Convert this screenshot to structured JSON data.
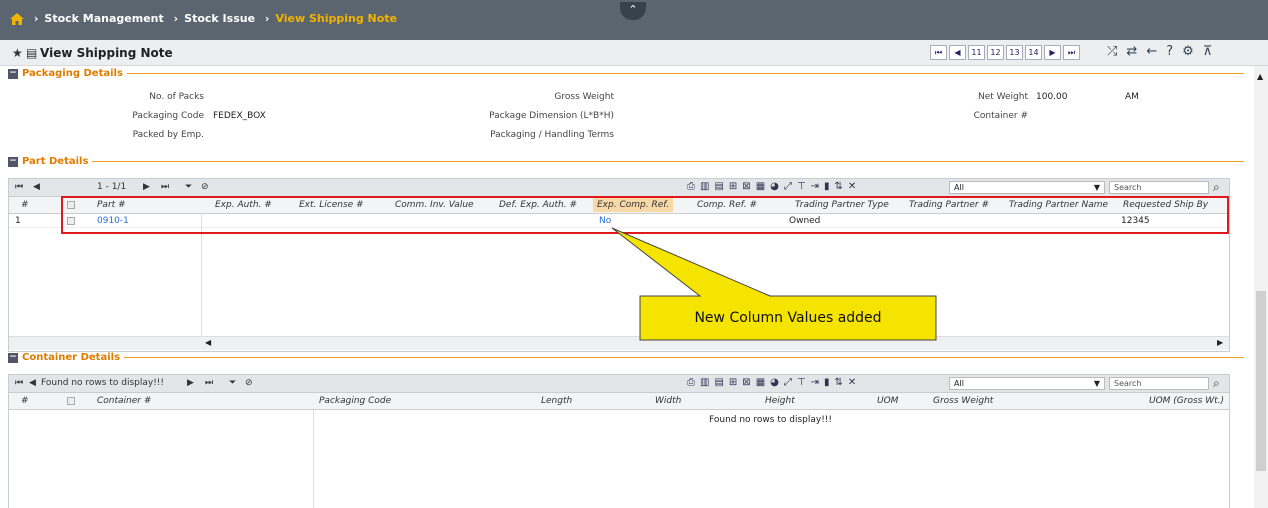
{
  "breadcrumb": {
    "items": [
      "Stock Management",
      "Stock Issue"
    ],
    "current": "View Shipping Note"
  },
  "page": {
    "title": "View Shipping Note"
  },
  "pager": {
    "pages": [
      "11",
      "12",
      "13",
      "14"
    ]
  },
  "packaging": {
    "section": "Packaging Details",
    "labels": {
      "packs": "No. of Packs",
      "code": "Packaging Code",
      "packed": "Packed by Emp.",
      "gross": "Gross Weight",
      "dim": "Package Dimension (L*B*H)",
      "terms": "Packaging / Handling Terms",
      "net": "Net Weight",
      "container": "Container #"
    },
    "values": {
      "code": "FEDEX_BOX",
      "net": "100.00",
      "net_unit": "AM"
    }
  },
  "parts": {
    "section": "Part Details",
    "page_info": "1 - 1/1",
    "filter": "All",
    "search_placeholder": "Search",
    "columns": [
      "#",
      "Part #",
      "Exp. Auth. #",
      "Ext. License #",
      "Comm. Inv. Value",
      "Def. Exp. Auth. #",
      "Exp. Comp. Ref.",
      "Comp. Ref. #",
      "Trading Partner Type",
      "Trading Partner #",
      "Trading Partner Name",
      "Requested Ship By"
    ],
    "rows": [
      {
        "idx": "1",
        "part": "0910-1",
        "exp_comp_ref": "No",
        "partner_type": "Owned",
        "ship_by": "12345"
      }
    ]
  },
  "containers": {
    "section": "Container Details",
    "page_info": "Found no rows to display!!!",
    "filter": "All",
    "search_placeholder": "Search",
    "columns": [
      "#",
      "Container #",
      "Packaging Code",
      "Length",
      "Width",
      "Height",
      "UOM",
      "Gross Weight",
      "UOM (Gross Wt.)"
    ],
    "empty": "Found no rows to display!!!"
  },
  "annotation": {
    "text": "New Column Values added",
    "box_color": "#e0191c",
    "callout_color": "#f5e400"
  }
}
